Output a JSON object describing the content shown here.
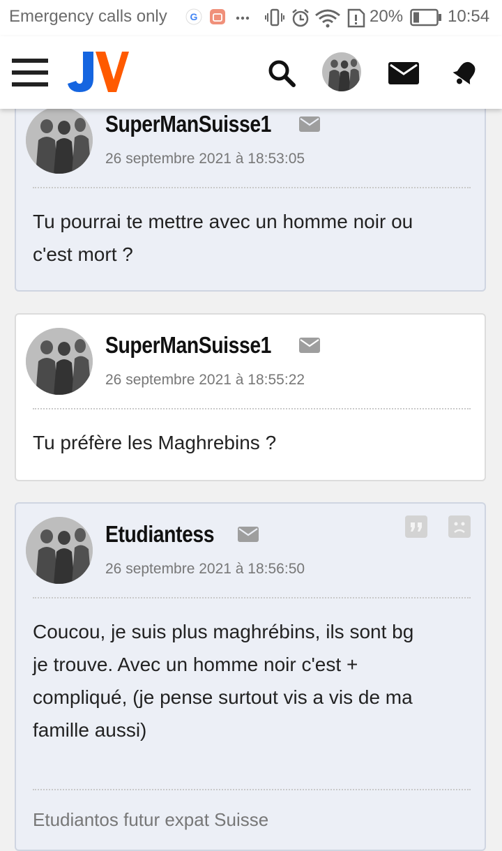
{
  "status_bar": {
    "carrier": "Emergency calls only",
    "battery": "20%",
    "time": "10:54"
  },
  "header": {
    "logo_text": "JV",
    "icons": [
      "menu-icon",
      "search-icon",
      "avatar",
      "mail-icon",
      "bell-icon"
    ]
  },
  "posts": [
    {
      "author": "SuperManSuisse1",
      "date": "26 septembre 2021 à 18:53:05",
      "lines": [
        "Tu pourrai te mettre avec un homme noir ou",
        "c'est mort ?"
      ]
    },
    {
      "author": "SuperManSuisse1",
      "date": "26 septembre 2021 à 18:55:22",
      "lines": [
        "Tu préfère les Maghrebins ?"
      ]
    },
    {
      "author": "Etudiantess",
      "date": "26 septembre 2021 à 18:56:50",
      "lines": [
        "Coucou, je suis plus maghrébins, ils sont bg",
        "je trouve. Avec un homme noir c'est +",
        "compliqué, (je pense surtout vis a vis de ma",
        "famille aussi)"
      ],
      "signature": "Etudiantos futur expat Suisse"
    }
  ],
  "colors": {
    "logo_blue": "#1565e0",
    "logo_orange": "#ff5a00",
    "card_alt_bg": "#eceff6"
  }
}
